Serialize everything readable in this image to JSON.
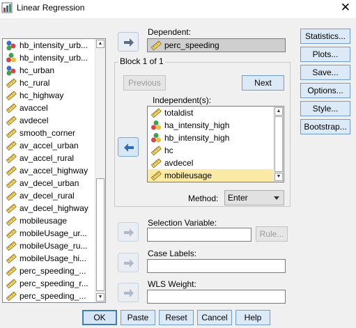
{
  "window": {
    "title": "Linear Regression",
    "close_label": "✕"
  },
  "variables": [
    {
      "label": "hb_intensity_urb...",
      "icon": "nominal-icon"
    },
    {
      "label": "hb_intensity_urb...",
      "icon": "ordinal-icon"
    },
    {
      "label": "hc_urban",
      "icon": "nominal-icon"
    },
    {
      "label": "hc_rural",
      "icon": "scale-icon"
    },
    {
      "label": "hc_highway",
      "icon": "scale-icon"
    },
    {
      "label": "avaccel",
      "icon": "scale-icon"
    },
    {
      "label": "avdecel",
      "icon": "scale-icon"
    },
    {
      "label": "smooth_corner",
      "icon": "scale-icon"
    },
    {
      "label": "av_accel_urban",
      "icon": "scale-icon"
    },
    {
      "label": "av_accel_rural",
      "icon": "scale-icon"
    },
    {
      "label": "av_accel_highway",
      "icon": "scale-icon"
    },
    {
      "label": "av_decel_urban",
      "icon": "scale-icon"
    },
    {
      "label": "av_decel_rural",
      "icon": "scale-icon"
    },
    {
      "label": "av_decel_highway",
      "icon": "scale-icon"
    },
    {
      "label": "mobileusage",
      "icon": "scale-icon"
    },
    {
      "label": "mobileUsage_ur...",
      "icon": "scale-icon"
    },
    {
      "label": "mobileUsage_ru...",
      "icon": "scale-icon"
    },
    {
      "label": "mobileUsage_hi...",
      "icon": "scale-icon"
    },
    {
      "label": "perc_speeding_...",
      "icon": "scale-icon"
    },
    {
      "label": "perc_speeding_r...",
      "icon": "scale-icon"
    },
    {
      "label": "perc_speeding_...",
      "icon": "scale-icon"
    }
  ],
  "dependent": {
    "label": "Dependent:",
    "value": "perc_speeding",
    "icon": "scale-icon"
  },
  "block": {
    "title": "Block 1 of 1",
    "previous_label": "Previous",
    "next_label": "Next",
    "independents_label": "Independent(s):",
    "independents": [
      {
        "label": "totaldist",
        "icon": "scale-icon",
        "selected": false
      },
      {
        "label": "ha_intensity_high",
        "icon": "ordinal-icon",
        "selected": false
      },
      {
        "label": "hb_intensity_high",
        "icon": "ordinal-icon",
        "selected": false
      },
      {
        "label": "hc",
        "icon": "scale-icon",
        "selected": false
      },
      {
        "label": "avdecel",
        "icon": "scale-icon",
        "selected": false
      },
      {
        "label": "mobileusage",
        "icon": "scale-icon",
        "selected": true
      }
    ],
    "method_label": "Method:",
    "method_value": "Enter"
  },
  "selection_variable": {
    "label": "Selection Variable:",
    "value": "",
    "rule_label": "Rule..."
  },
  "case_labels": {
    "label": "Case Labels:",
    "value": ""
  },
  "wls_weight": {
    "label": "WLS Weight:",
    "value": ""
  },
  "side_buttons": [
    "Statistics...",
    "Plots...",
    "Save...",
    "Options...",
    "Style...",
    "Bootstrap..."
  ],
  "bottom_buttons": [
    "OK",
    "Paste",
    "Reset",
    "Cancel",
    "Help"
  ],
  "colors": {
    "accent": "#3c7fb1",
    "selection": "#fbe9a6",
    "panel": "#f0f0f0"
  }
}
